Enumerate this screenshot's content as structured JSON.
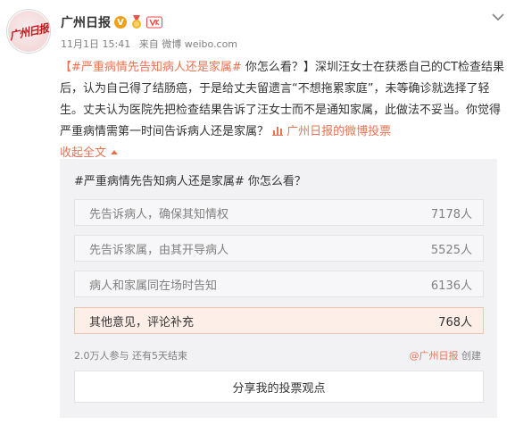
{
  "author": {
    "name": "广州日报",
    "avatar_text": "广州日报"
  },
  "meta": {
    "time": "11月1日 15:41",
    "source": "来自 微博 weibo.com"
  },
  "post": {
    "topic": "【#严重病情先告知病人还是家属#",
    "question": " 你怎么看？】",
    "body": "深圳汪女士在获悉自己的CT检查结果后，认为自己得了结肠癌，于是给丈夫留遗言“不想拖累家庭”，未等确诊就选择了轻生。丈夫认为医院先把检查结果告诉了汪女士而不是通知家属，此做法不妥当。你觉得严重病情需第一时间告诉病人还是家属？",
    "vote_link": "广州日报的微博投票",
    "collapse": "收起全文"
  },
  "poll": {
    "title": "#严重病情先告知病人还是家属# 你怎么看？",
    "options": [
      {
        "label": "先告诉病人，确保其知情权",
        "count": "7178人"
      },
      {
        "label": "先告诉家属，由其开导病人",
        "count": "5525人"
      },
      {
        "label": "病人和家属同在场时告知",
        "count": "6136人"
      },
      {
        "label": "其他意见，评论补充",
        "count": "768人"
      }
    ],
    "participants": "2.0万人参与",
    "remaining": "还有5天结束",
    "creator": "@广州日报",
    "created": "创建",
    "share": "分享我的投票观点"
  },
  "colors": {
    "link": "#eb7350",
    "selected_bg": "#fdeee8"
  },
  "icons": [
    "verified-v-icon",
    "medal-icon",
    "member-icon",
    "chevron-down-icon",
    "vote-bar-icon"
  ]
}
